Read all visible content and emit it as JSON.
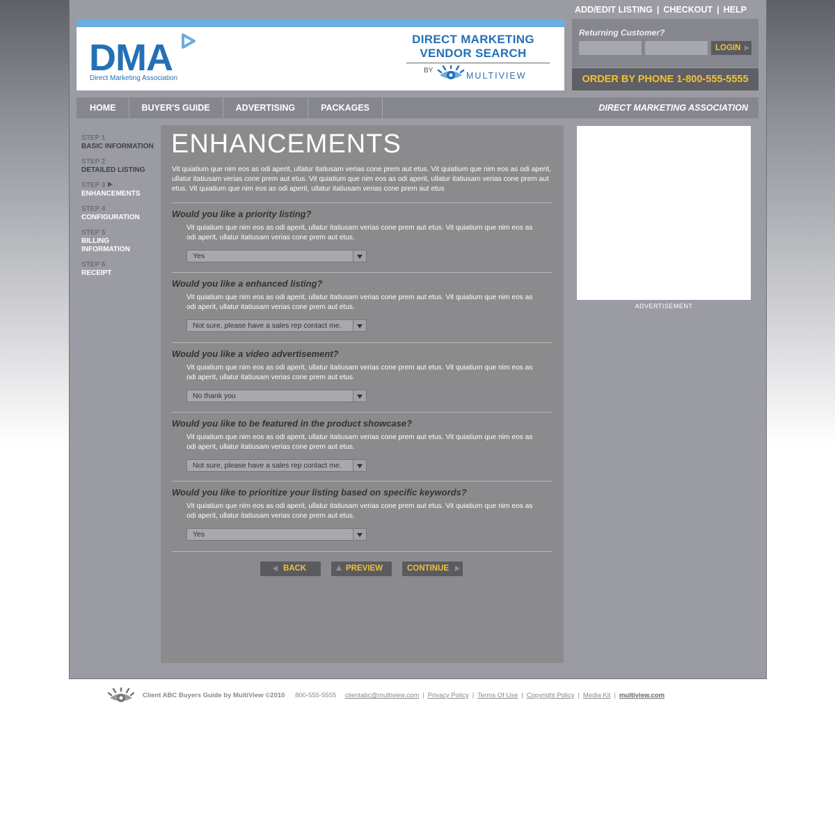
{
  "top_links": [
    "ADD/EDIT LISTING",
    "CHECKOUT",
    "HELP"
  ],
  "top_separator": "|",
  "header": {
    "logo_text": "DMA",
    "logo_subtitle": "Direct Marketing Association",
    "vendor_line1": "DIRECT MARKETING",
    "vendor_line2": "VENDOR SEARCH",
    "by": "BY",
    "multiview": "MULTIVIEW"
  },
  "login": {
    "label": "Returning Customer?",
    "button": "LOGIN",
    "username_value": "",
    "password_value": ""
  },
  "phone": "ORDER BY PHONE 1-800-555-5555",
  "nav": {
    "items": [
      "HOME",
      "BUYER'S GUIDE",
      "ADVERTISING",
      "PACKAGES"
    ],
    "association": "DIRECT MARKETING ASSOCIATION"
  },
  "steps": [
    {
      "num": "STEP 1",
      "name": "BASIC INFORMATION"
    },
    {
      "num": "STEP 2",
      "name": "DETAILED LISTING"
    },
    {
      "num": "STEP 3",
      "name": "ENHANCEMENTS"
    },
    {
      "num": "STEP 4",
      "name": "CONFIGURATION"
    },
    {
      "num": "STEP 5",
      "name": "BILLING INFORMATION"
    },
    {
      "num": "STEP 6",
      "name": "RECEIPT"
    }
  ],
  "main": {
    "title": "ENHANCEMENTS",
    "intro": "Vit quiatium que nim eos as odi aperit, ullatur itatiusam verias cone prem aut etus. Vit quiatium que nim eos as odi aperit, ullatur itatiusam verias cone prem aut etus. Vit quiatium que nim eos as odi aperit, ullatur itatiusam verias cone prem aut etus. Vit quiatium que nim eos as odi aperit, ullatur itatiusam verias cone prem aut etus",
    "questions": [
      {
        "title": "Would you like a priority listing?",
        "desc": "Vit quiatium que nim eos as odi aperit, ullatur itatiusam verias cone prem aut etus. Vit quiatium que nim eos as odi aperit, ullatur itatiusam verias cone prem aut etus.",
        "value": "Yes"
      },
      {
        "title": "Would you like a enhanced listing?",
        "desc": "Vit quiatium que nim eos as odi aperit, ullatur itatiusam verias cone prem aut etus. Vit quiatium que nim eos as odi aperit, ullatur itatiusam verias cone prem aut etus.",
        "value": "Not sure, please have a sales rep contact me."
      },
      {
        "title": "Would you like a video advertisement?",
        "desc": "Vit quiatium que nim eos as odi aperit, ullatur itatiusam verias cone prem aut etus. Vit quiatium que nim eos as odi aperit, ullatur itatiusam verias cone prem aut etus.",
        "value": "No thank you"
      },
      {
        "title": "Would you like to be featured in the product showcase?",
        "desc": "Vit quiatium que nim eos as odi aperit, ullatur itatiusam verias cone prem aut etus. Vit quiatium que nim eos as odi aperit, ullatur itatiusam verias cone prem aut etus.",
        "value": "Not sure, please have a sales rep contact me."
      },
      {
        "title": "Would you like to prioritize your listing based on specific keywords?",
        "desc": "Vit quiatium que nim eos as odi aperit, ullatur itatiusam verias cone prem aut etus. Vit quiatium que nim eos as odi aperit, ullatur itatiusam verias cone prem aut etus.",
        "value": "Yes"
      }
    ],
    "buttons": {
      "back": "BACK",
      "preview": "PREVIEW",
      "continue": "CONTINUE"
    }
  },
  "ad_label": "ADVERTISEMENT",
  "footer": {
    "copyright": "Client ABC Buyers Guide by MultiView ©2010",
    "phone": "800-555-5555",
    "email": "clientabc@multiview.com",
    "links": [
      "Privacy Policy",
      "Terms Of Use",
      "Copyright Policy",
      "Media Kit"
    ],
    "site": "multiview.com"
  },
  "colors": {
    "brand_blue": "#2470b6",
    "accent_yellow": "#f1c232",
    "panel_gray": "#8b8b8d",
    "page_gray": "#9b9ca3"
  }
}
